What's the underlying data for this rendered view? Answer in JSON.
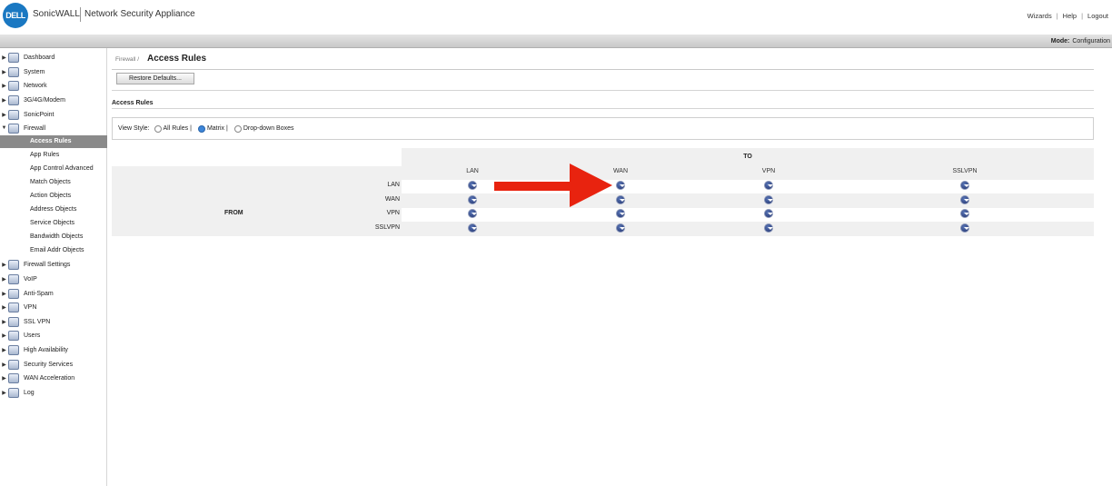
{
  "header": {
    "logo_text": "DELL",
    "brand": "SonicWALL",
    "product": "Network Security Appliance",
    "links": [
      "Wizards",
      "Help",
      "Logout"
    ],
    "mode_label": "Mode:",
    "mode_value": "Configuration"
  },
  "sidebar": {
    "items": [
      {
        "label": "Dashboard",
        "icon": "dashboard-icon"
      },
      {
        "label": "System",
        "icon": "system-icon"
      },
      {
        "label": "Network",
        "icon": "network-icon"
      },
      {
        "label": "3G/4G/Modem",
        "icon": "modem-icon"
      },
      {
        "label": "SonicPoint",
        "icon": "sonicpoint-icon"
      },
      {
        "label": "Firewall",
        "icon": "firewall-icon"
      }
    ],
    "firewall_sub": [
      "Access Rules",
      "App Rules",
      "App Control Advanced",
      "Match Objects",
      "Action Objects",
      "Address Objects",
      "Service Objects",
      "Bandwidth Objects",
      "Email Addr Objects"
    ],
    "items_after": [
      {
        "label": "Firewall Settings",
        "icon": "firewall-settings-icon"
      },
      {
        "label": "VoIP",
        "icon": "voip-icon"
      },
      {
        "label": "Anti-Spam",
        "icon": "anti-spam-icon"
      },
      {
        "label": "VPN",
        "icon": "vpn-icon"
      },
      {
        "label": "SSL VPN",
        "icon": "ssl-vpn-icon"
      },
      {
        "label": "Users",
        "icon": "users-icon"
      },
      {
        "label": "High Availability",
        "icon": "high-availability-icon"
      },
      {
        "label": "Security Services",
        "icon": "security-services-icon"
      },
      {
        "label": "WAN Acceleration",
        "icon": "wan-acceleration-icon"
      },
      {
        "label": "Log",
        "icon": "log-icon"
      }
    ]
  },
  "main": {
    "breadcrumb": "Firewall /",
    "title": "Access Rules",
    "restore_button": "Restore Defaults...",
    "section_title": "Access Rules",
    "view_style": {
      "label": "View Style:",
      "options": [
        "All Rules",
        "Matrix",
        "Drop-down Boxes"
      ],
      "selected": "Matrix",
      "separator": "|"
    },
    "matrix": {
      "to_label": "TO",
      "from_label": "FROM",
      "columns": [
        "LAN",
        "WAN",
        "VPN",
        "SSLVPN"
      ],
      "rows": [
        "LAN",
        "WAN",
        "VPN",
        "SSLVPN"
      ]
    }
  },
  "annotation": {
    "arrow_color": "#e8230f"
  }
}
